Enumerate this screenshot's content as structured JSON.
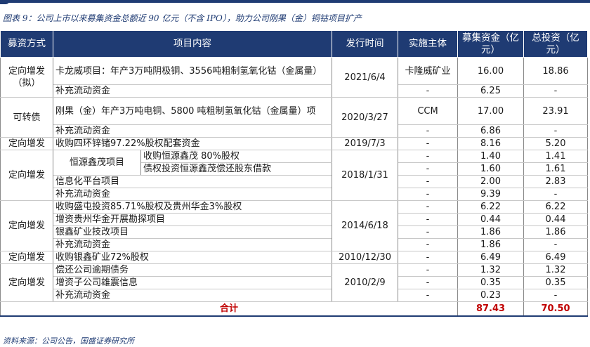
{
  "title": "图表 9：公司上市以来募集资金总额近 90 亿元（不含 IPO），助力公司刚果（金）铜钴项目扩产",
  "headers": {
    "method": "募资方式",
    "project": "项目内容",
    "date": "发行时间",
    "entity": "实施主体",
    "raised": "募集资金（亿元）",
    "total": "总投资（亿元）"
  },
  "rows": {
    "g1": {
      "method": "定向增发（拟）",
      "date": "2021/6/4",
      "r1": {
        "project": "卡龙威项目：年产3万吨阴极铜、3556吨粗制氢氧化钴（金属量）",
        "entity": "卡隆威矿业",
        "raised": "16.00",
        "total": "18.86"
      },
      "r2": {
        "project": "补充流动资金",
        "entity": "-",
        "raised": "6.25",
        "total": "-"
      }
    },
    "g2": {
      "method": "可转债",
      "date": "2020/3/27",
      "r1": {
        "project": "刚果（金）年产3万吨电铜、5800 吨粗制氢氧化钴（金属量）项",
        "entity": "CCM",
        "raised": "17.00",
        "total": "23.91"
      },
      "r2": {
        "project": "补充流动资金",
        "entity": "-",
        "raised": "6.86",
        "total": "-"
      }
    },
    "g3": {
      "method": "定向增发",
      "date": "2019/7/3",
      "r1": {
        "project": "收购四环锌锗97.22%股权配套资金",
        "entity": "-",
        "raised": "8.16",
        "total": "5.20"
      }
    },
    "g4": {
      "method": "定向增发",
      "date": "2018/1/31",
      "parent": "恒源鑫茂项目",
      "r1": {
        "project": "收购恒源鑫茂 80%股权",
        "entity": "-",
        "raised": "1.40",
        "total": "1.41"
      },
      "r2": {
        "project": "债权投资恒源鑫茂偿还股东借款",
        "entity": "-",
        "raised": "1.60",
        "total": "1.61"
      },
      "r3": {
        "project": "信息化平台项目",
        "entity": "-",
        "raised": "2.00",
        "total": "2.83"
      },
      "r4": {
        "project": "补充流动资金",
        "entity": "-",
        "raised": "9.39",
        "total": "-"
      }
    },
    "g5": {
      "method": "定向增发",
      "date": "2014/6/18",
      "r1": {
        "project": "收购盛屯投资85.71%股权及贵州华金3%股权",
        "entity": "-",
        "raised": "6.22",
        "total": "6.22"
      },
      "r2": {
        "project": "增资贵州华金开展勘探项目",
        "entity": "-",
        "raised": "0.44",
        "total": "0.44"
      },
      "r3": {
        "project": "银鑫矿业技改项目",
        "entity": "-",
        "raised": "1.86",
        "total": "1.86"
      },
      "r4": {
        "project": "补充流动资金",
        "entity": "-",
        "raised": "1.86",
        "total": "-"
      }
    },
    "g6": {
      "method": "定向增发",
      "date": "2010/12/30",
      "r1": {
        "project": "收购银鑫矿业72%股权",
        "entity": "-",
        "raised": "6.49",
        "total": "6.49"
      }
    },
    "g7": {
      "method": "定向增发",
      "date": "2010/2/9",
      "r1": {
        "project": "偿还公司逾期债务",
        "entity": "-",
        "raised": "1.32",
        "total": "1.32"
      },
      "r2": {
        "project": "增资子公司雄震信息",
        "entity": "-",
        "raised": "0.35",
        "total": "0.35"
      },
      "r3": {
        "project": "补充流动资金",
        "entity": "-",
        "raised": "0.23",
        "total": "-"
      }
    }
  },
  "total": {
    "label": "合计",
    "raised": "87.43",
    "total": "70.50"
  },
  "source": "资料来源：公司公告，国盛证券研究所",
  "colors": {
    "header_bg": "#1f3b73",
    "total_text": "#c00000"
  }
}
